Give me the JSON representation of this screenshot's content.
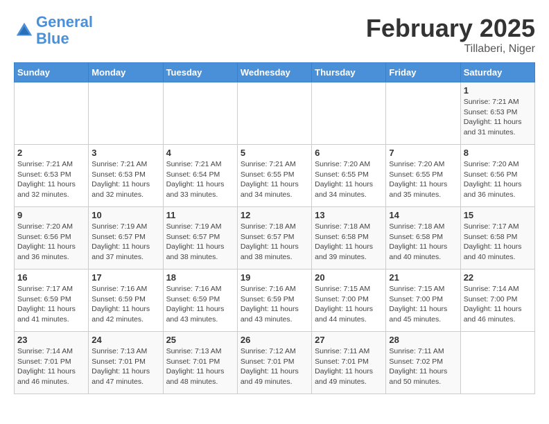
{
  "header": {
    "logo_line1": "General",
    "logo_line2": "Blue",
    "month_title": "February 2025",
    "location": "Tillaberi, Niger"
  },
  "weekdays": [
    "Sunday",
    "Monday",
    "Tuesday",
    "Wednesday",
    "Thursday",
    "Friday",
    "Saturday"
  ],
  "weeks": [
    [
      {
        "day": "",
        "info": ""
      },
      {
        "day": "",
        "info": ""
      },
      {
        "day": "",
        "info": ""
      },
      {
        "day": "",
        "info": ""
      },
      {
        "day": "",
        "info": ""
      },
      {
        "day": "",
        "info": ""
      },
      {
        "day": "1",
        "info": "Sunrise: 7:21 AM\nSunset: 6:53 PM\nDaylight: 11 hours and 31 minutes."
      }
    ],
    [
      {
        "day": "2",
        "info": "Sunrise: 7:21 AM\nSunset: 6:53 PM\nDaylight: 11 hours and 32 minutes."
      },
      {
        "day": "3",
        "info": "Sunrise: 7:21 AM\nSunset: 6:53 PM\nDaylight: 11 hours and 32 minutes."
      },
      {
        "day": "4",
        "info": "Sunrise: 7:21 AM\nSunset: 6:54 PM\nDaylight: 11 hours and 33 minutes."
      },
      {
        "day": "5",
        "info": "Sunrise: 7:21 AM\nSunset: 6:55 PM\nDaylight: 11 hours and 34 minutes."
      },
      {
        "day": "6",
        "info": "Sunrise: 7:20 AM\nSunset: 6:55 PM\nDaylight: 11 hours and 34 minutes."
      },
      {
        "day": "7",
        "info": "Sunrise: 7:20 AM\nSunset: 6:55 PM\nDaylight: 11 hours and 35 minutes."
      },
      {
        "day": "8",
        "info": "Sunrise: 7:20 AM\nSunset: 6:56 PM\nDaylight: 11 hours and 36 minutes."
      }
    ],
    [
      {
        "day": "9",
        "info": "Sunrise: 7:20 AM\nSunset: 6:56 PM\nDaylight: 11 hours and 36 minutes."
      },
      {
        "day": "10",
        "info": "Sunrise: 7:19 AM\nSunset: 6:57 PM\nDaylight: 11 hours and 37 minutes."
      },
      {
        "day": "11",
        "info": "Sunrise: 7:19 AM\nSunset: 6:57 PM\nDaylight: 11 hours and 38 minutes."
      },
      {
        "day": "12",
        "info": "Sunrise: 7:18 AM\nSunset: 6:57 PM\nDaylight: 11 hours and 38 minutes."
      },
      {
        "day": "13",
        "info": "Sunrise: 7:18 AM\nSunset: 6:58 PM\nDaylight: 11 hours and 39 minutes."
      },
      {
        "day": "14",
        "info": "Sunrise: 7:18 AM\nSunset: 6:58 PM\nDaylight: 11 hours and 40 minutes."
      },
      {
        "day": "15",
        "info": "Sunrise: 7:17 AM\nSunset: 6:58 PM\nDaylight: 11 hours and 40 minutes."
      }
    ],
    [
      {
        "day": "16",
        "info": "Sunrise: 7:17 AM\nSunset: 6:59 PM\nDaylight: 11 hours and 41 minutes."
      },
      {
        "day": "17",
        "info": "Sunrise: 7:16 AM\nSunset: 6:59 PM\nDaylight: 11 hours and 42 minutes."
      },
      {
        "day": "18",
        "info": "Sunrise: 7:16 AM\nSunset: 6:59 PM\nDaylight: 11 hours and 43 minutes."
      },
      {
        "day": "19",
        "info": "Sunrise: 7:16 AM\nSunset: 6:59 PM\nDaylight: 11 hours and 43 minutes."
      },
      {
        "day": "20",
        "info": "Sunrise: 7:15 AM\nSunset: 7:00 PM\nDaylight: 11 hours and 44 minutes."
      },
      {
        "day": "21",
        "info": "Sunrise: 7:15 AM\nSunset: 7:00 PM\nDaylight: 11 hours and 45 minutes."
      },
      {
        "day": "22",
        "info": "Sunrise: 7:14 AM\nSunset: 7:00 PM\nDaylight: 11 hours and 46 minutes."
      }
    ],
    [
      {
        "day": "23",
        "info": "Sunrise: 7:14 AM\nSunset: 7:01 PM\nDaylight: 11 hours and 46 minutes."
      },
      {
        "day": "24",
        "info": "Sunrise: 7:13 AM\nSunset: 7:01 PM\nDaylight: 11 hours and 47 minutes."
      },
      {
        "day": "25",
        "info": "Sunrise: 7:13 AM\nSunset: 7:01 PM\nDaylight: 11 hours and 48 minutes."
      },
      {
        "day": "26",
        "info": "Sunrise: 7:12 AM\nSunset: 7:01 PM\nDaylight: 11 hours and 49 minutes."
      },
      {
        "day": "27",
        "info": "Sunrise: 7:11 AM\nSunset: 7:01 PM\nDaylight: 11 hours and 49 minutes."
      },
      {
        "day": "28",
        "info": "Sunrise: 7:11 AM\nSunset: 7:02 PM\nDaylight: 11 hours and 50 minutes."
      },
      {
        "day": "",
        "info": ""
      }
    ]
  ]
}
